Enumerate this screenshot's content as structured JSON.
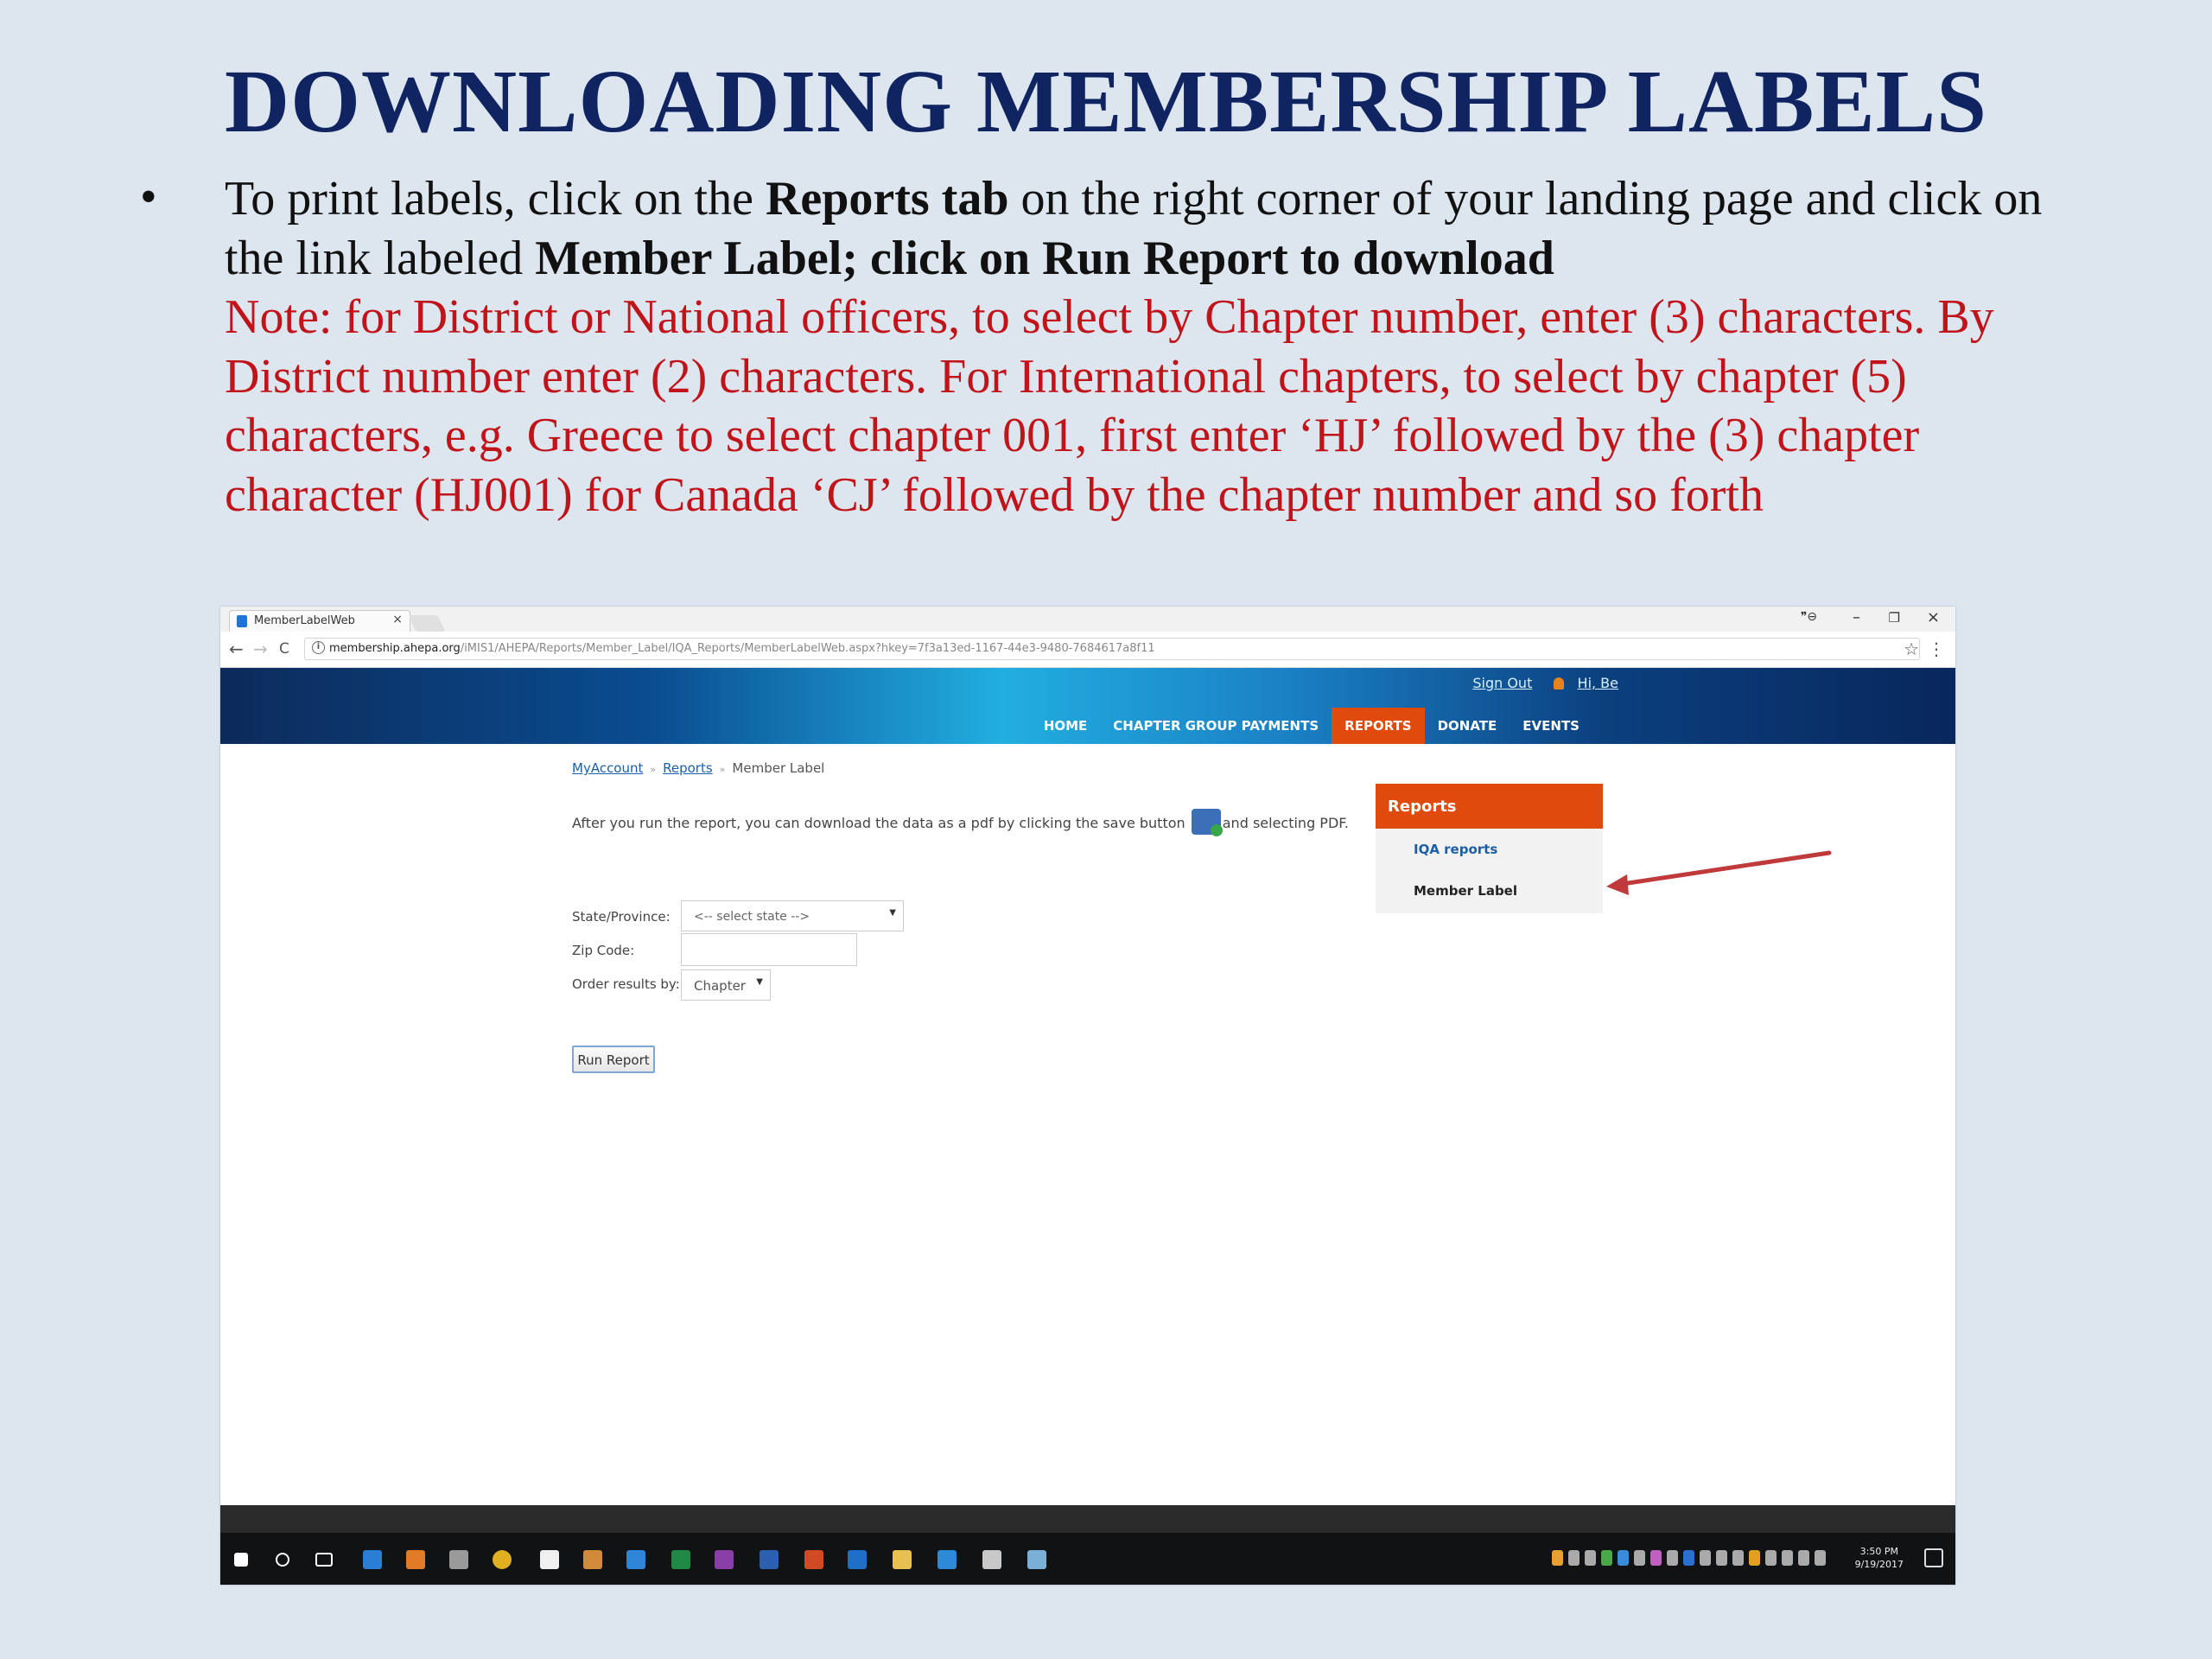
{
  "slide": {
    "title": "DOWNLOADING MEMBERSHIP LABELS",
    "bullet": "•",
    "line1_a": "To print labels, click on the ",
    "line1_b": "Reports tab",
    "line1_c": " on the right corner of your landing page and click on the link labeled ",
    "line1_d": "Member Label; click on Run Report to download",
    "note": "Note: for District or National officers, to select by Chapter number, enter (3) characters. By District number enter (2) characters. For International chapters, to select by chapter (5) characters, e.g. Greece to select chapter 001, first enter ‘HJ’ followed by the (3) chapter character (HJ001) for Canada ‘CJ’ followed by the chapter number and so forth"
  },
  "browser": {
    "tab_title": "MemberLabelWeb",
    "tab_close": "×",
    "url_domain": "membership.ahepa.org",
    "url_path": "/iMIS1/AHEPA/Reports/Member_Label/IQA_Reports/MemberLabelWeb.aspx?hkey=7f3a13ed-1167-44e3-9480-7684617a8f11",
    "info_icon": "i",
    "back_icon": "←",
    "forward_icon": "→",
    "reload_icon": "C",
    "star_icon": "☆",
    "menu_icon": "⋮",
    "minimize": "–",
    "maximize": "❐",
    "close": "×",
    "profile": "❞⊖"
  },
  "site": {
    "sign_out": "Sign Out",
    "user": "Hi, Be",
    "menu": [
      "HOME",
      "CHAPTER GROUP PAYMENTS",
      "REPORTS",
      "DONATE",
      "EVENTS"
    ],
    "breadcrumb": [
      "MyAccount",
      "Reports",
      "Member Label"
    ],
    "breadcrumb_sep": "»",
    "instruction_a": "After you run the report, you can download the data as a pdf by clicking the save button",
    "instruction_b": "and selecting PDF.",
    "form": {
      "state_label": "State/Province:",
      "state_value": "<-- select state -->",
      "zip_label": "Zip Code:",
      "zip_value": "",
      "order_label": "Order results by:",
      "order_value": "Chapter",
      "caret": "▼",
      "run_button": "Run Report"
    },
    "side_panel": {
      "title": "Reports",
      "links": [
        "IQA reports",
        "Member Label"
      ]
    }
  },
  "taskbar": {
    "time": "3:50 PM",
    "date": "9/19/2017"
  },
  "colors": {
    "title": "#0f2460",
    "note": "#c0141a",
    "accent_orange": "#e04a0c",
    "arrow": "#c0393b"
  }
}
